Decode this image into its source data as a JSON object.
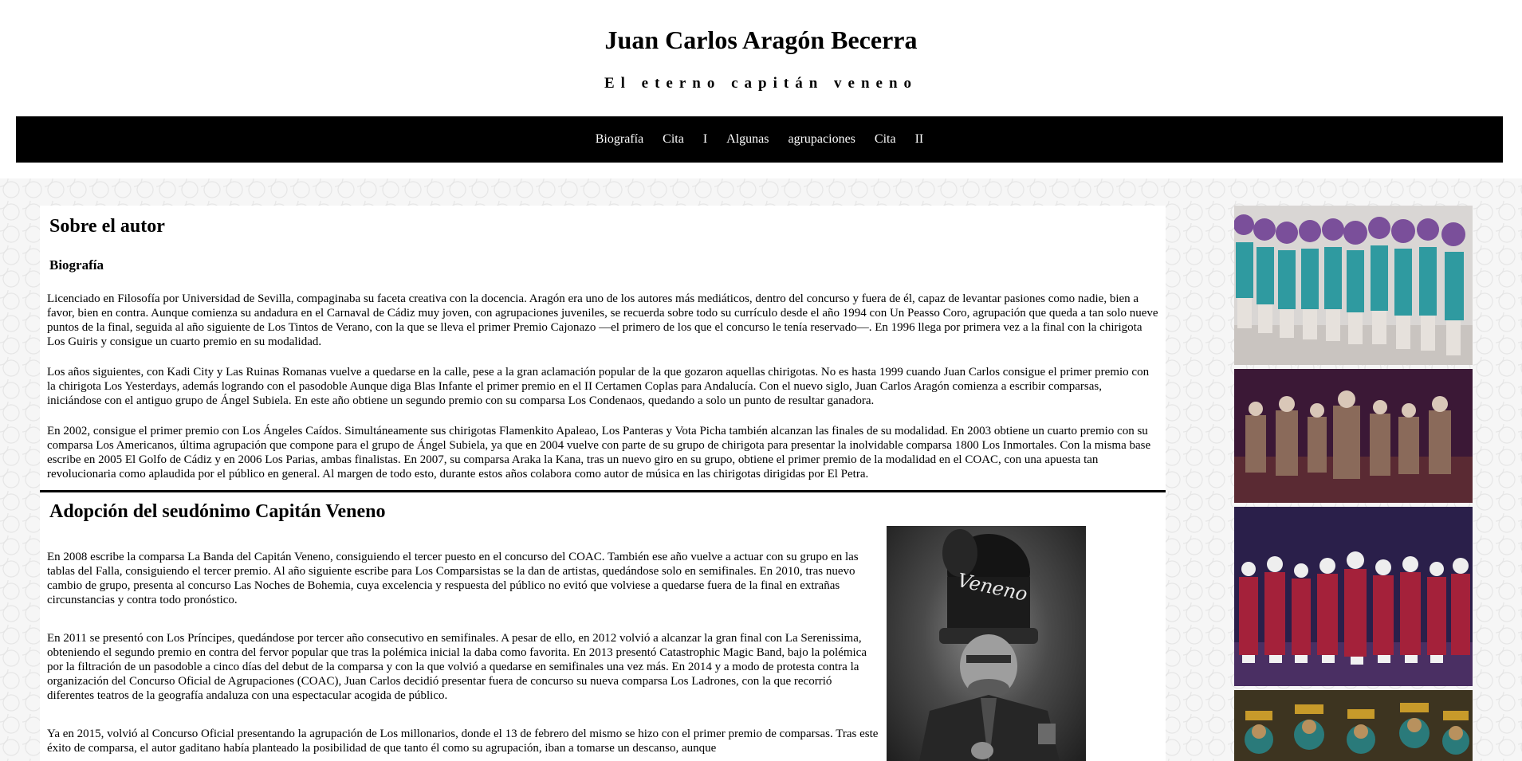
{
  "header": {
    "title": "Juan Carlos Aragón Becerra",
    "subtitle": "El eterno capitán veneno"
  },
  "nav": {
    "items": [
      "Biografía",
      "Cita",
      "I",
      "Algunas",
      "agrupaciones",
      "Cita",
      "II"
    ]
  },
  "sections": {
    "author": {
      "title": "Sobre el autor",
      "subtitle": "Biografía",
      "paragraphs": [
        "Licenciado en Filosofía por Universidad de Sevilla, compaginaba su faceta creativa con la docencia. Aragón era uno de los autores más mediáticos, dentro del concurso y fuera de él, capaz de levantar pasiones como nadie, bien a favor, bien en contra. Aunque comienza su andadura en el Carnaval de Cádiz muy joven, con agrupaciones juveniles, se recuerda sobre todo su currículo desde el año 1994 con Un Peasso Coro, agrupación que queda a tan solo nueve puntos de la final, seguida al año siguiente de Los Tintos de Verano, con la que se lleva el primer Premio Cajonazo —el primero de los que el concurso le tenía reservado—. En 1996 llega por primera vez a la final con la chirigota Los Guiris y consigue un cuarto premio en su modalidad.",
        "Los años siguientes, con Kadi City y Las Ruinas Romanas vuelve a quedarse en la calle, pese a la gran aclamación popular de la que gozaron aquellas chirigotas. No es hasta 1999 cuando Juan Carlos consigue el primer premio con la chirigota Los Yesterdays, además logrando con el pasodoble Aunque diga Blas Infante el primer premio en el II Certamen Coplas para Andalucía. Con el nuevo siglo, Juan Carlos Aragón comienza a escribir comparsas, iniciándose con el antiguo grupo de Ángel Subiela. En este año obtiene un segundo premio con su comparsa Los Condenaos, quedando a solo un punto de resultar ganadora.",
        "En 2002, consigue el primer premio con Los Ángeles Caídos. Simultáneamente sus chirigotas Flamenkito Apaleao, Los Panteras y Vota Picha también alcanzan las finales de su modalidad. En 2003 obtiene un cuarto premio con su comparsa Los Americanos, última agrupación que compone para el grupo de Ángel Subiela, ya que en 2004 vuelve con parte de su grupo de chirigota para presentar la inolvidable comparsa 1800 Los Inmortales. Con la misma base escribe en 2005 El Golfo de Cádiz y en 2006 Los Parias, ambas finalistas. En 2007, su comparsa Araka la Kana, tras un nuevo giro en su grupo, obtiene el primer premio de la modalidad en el COAC, con una apuesta tan revolucionaria como aplaudida por el público en general. Al margen de todo esto, durante estos años colabora como autor de música en las chirigotas dirigidas por El Petra."
      ]
    },
    "pseudonym": {
      "title": "Adopción del seudónimo Capitán Veneno",
      "paragraphs": [
        "En 2008 escribe la comparsa La Banda del Capitán Veneno, consiguiendo el tercer puesto en el concurso del COAC. También ese año vuelve a actuar con su grupo en las tablas del Falla, consiguiendo el tercer premio. Al año siguiente escribe para Los Comparsistas se la dan de artistas, quedándose solo en semifinales. En 2010, tras nuevo cambio de grupo, presenta al concurso Las Noches de Bohemia, cuya excelencia y respuesta del público no evitó que volviese a quedarse fuera de la final en extrañas circunstancias y contra todo pronóstico.",
        "En 2011 se presentó con Los Príncipes, quedándose por tercer año consecutivo en semifinales. A pesar de ello, en 2012 volvió a alcanzar la gran final con La Serenissima, obteniendo el segundo premio en contra del fervor popular que tras la polémica inicial la daba como favorita. En 2013 presentó Catastrophic Magic Band, bajo la polémica por la filtración de un pasodoble a cinco días del debut de la comparsa y con la que volvió a quedarse en semifinales una vez más. En 2014 y a modo de protesta contra la organización del Concurso Oficial de Agrupaciones (COAC), Juan Carlos decidió presentar fuera de concurso su nueva comparsa Los Ladrones, con la que recorrió diferentes teatros de la geografía andaluza con una espectacular acogida de público.",
        "Ya en 2015, volvió al Concurso Oficial presentando la agrupación de Los millonarios, donde el 13 de febrero del mismo se hizo con el primer premio de comparsas. Tras este éxito de comparsa, el autor gaditano había planteado la posibilidad de que tanto él como su agrupación, iban a tomarse un descanso, aunque"
      ],
      "portrait_hat_text": "Veneno"
    }
  },
  "colors": {
    "nav_bg": "#000000",
    "nav_text": "#ffffff",
    "page_bg": "#ffffff",
    "pattern_bg": "#f6f6f6"
  }
}
